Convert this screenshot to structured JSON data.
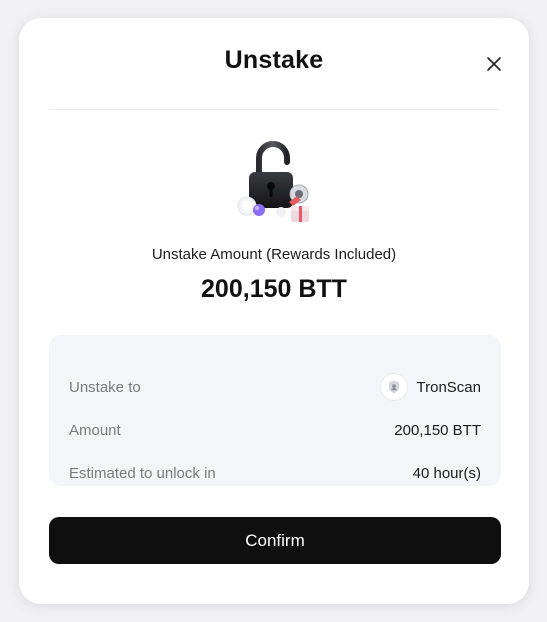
{
  "modal": {
    "title": "Unstake",
    "close_icon": "close-icon",
    "illustration_icon": "padlock-illustration"
  },
  "summary": {
    "label": "Unstake Amount (Rewards Included)",
    "amount": "200,150 BTT"
  },
  "details": {
    "rows": [
      {
        "label": "Unstake to",
        "value": "TronScan",
        "icon": "tronscan-logo-icon"
      },
      {
        "label": "Amount",
        "value": "200,150 BTT"
      },
      {
        "label": "Estimated to unlock in",
        "value": "40 hour(s)"
      }
    ]
  },
  "actions": {
    "confirm_label": "Confirm"
  },
  "colors": {
    "background": "#f2f2f4",
    "modal": "#ffffff",
    "details_panel": "#f4f5f9",
    "primary_button": "#0f0f10",
    "muted_text": "#7a7b80",
    "text": "#111111"
  }
}
